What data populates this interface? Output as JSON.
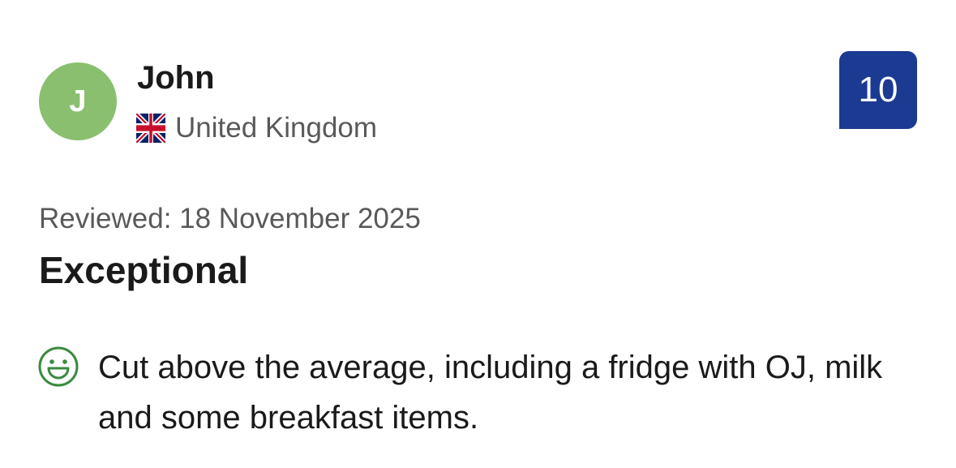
{
  "reviewer": {
    "initial": "J",
    "name": "John",
    "country": "United Kingdom",
    "flag_icon": "uk-flag-icon"
  },
  "score": {
    "value": "10",
    "color": "#1b3a91"
  },
  "review": {
    "date": "Reviewed: 18 November 2025",
    "title": "Exceptional",
    "positive_icon": "smile-icon",
    "positive_text": "Cut above the average, including a fridge with OJ, milk and some breakfast items."
  },
  "colors": {
    "avatar_bg": "#8abf6f",
    "positive_icon": "#3a8a3f",
    "muted_text": "#595959"
  }
}
